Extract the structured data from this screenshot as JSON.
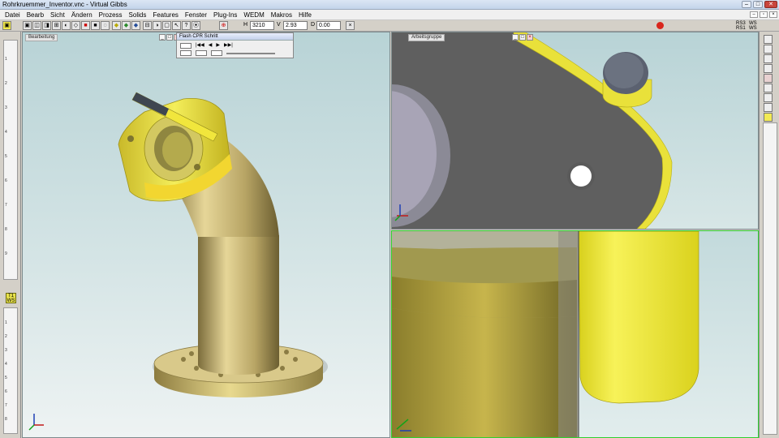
{
  "window": {
    "title": "Rohrkruemmer_Inventor.vnc - Virtual Gibbs",
    "min_label": "–",
    "max_label": "□",
    "close_label": "✕"
  },
  "menu": {
    "items": [
      "Datei",
      "Bearb",
      "Sicht",
      "Ändern",
      "Prozess",
      "Solids",
      "Features",
      "Fenster",
      "Plug-Ins",
      "WEDM",
      "Makros",
      "Hilfe"
    ]
  },
  "toolbar": {
    "h_label": "H",
    "h_value": "3210",
    "v_label": "V",
    "v_value": "2.93",
    "d_label": "D",
    "d_value": "0.00",
    "right_text_1": "RS3",
    "right_text_2": "WS",
    "right_text_3": "RS1",
    "right_text_4": "WS"
  },
  "viewports": {
    "left": {
      "caption": "Bearbeitung"
    },
    "top_right": {
      "caption": "Arbeitsgruppe"
    }
  },
  "flash_panel": {
    "title": "Flash CPR Schritt",
    "play_symbols": [
      "|◀◀",
      "◀",
      "▶",
      "▶▶|"
    ]
  },
  "left_strip": {
    "ws_icon_1": "T1 WS",
    "ws_icon_2": "T1 WS",
    "ruler_numbers": [
      "1",
      "2",
      "3",
      "4",
      "5",
      "6",
      "7",
      "8",
      "9",
      "1",
      "2",
      "3",
      "4",
      "5",
      "6",
      "7",
      "8",
      "9"
    ]
  },
  "colors": {
    "part_yellow": "#e8e030",
    "part_bronze": "#b4a36a",
    "viewport_bg": "#c9dddf",
    "grey_body": "#626262"
  }
}
